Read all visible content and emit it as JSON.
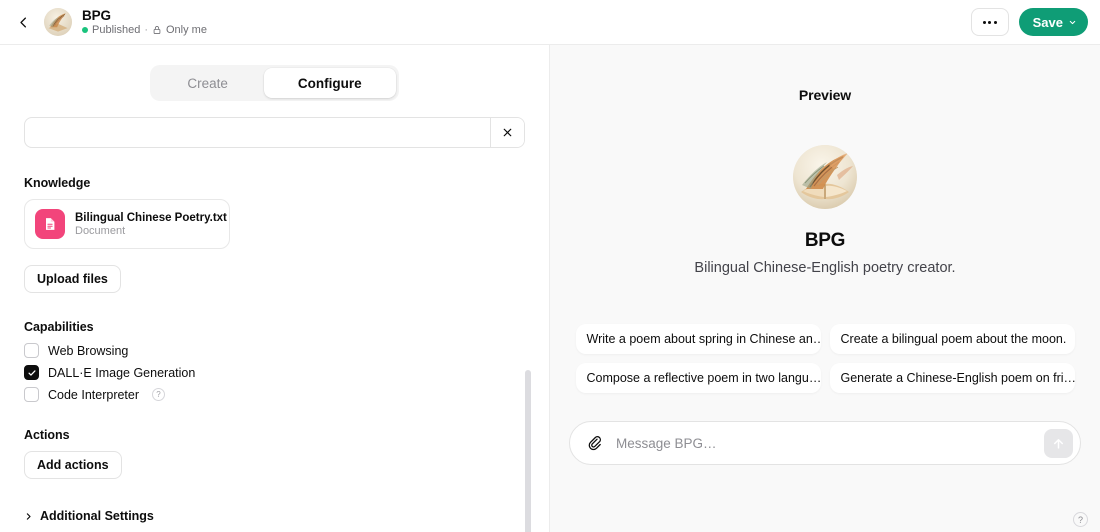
{
  "header": {
    "back_icon": "chevron-left-icon",
    "title": "BPG",
    "status": "Published",
    "separator": "·",
    "visibility": "Only me",
    "lock_icon": "lock-icon",
    "more_label": "more-options",
    "save_label": "Save",
    "accent_color": "#0f9d76",
    "status_dot_color": "#19c37d"
  },
  "tabs": [
    {
      "label": "Create",
      "active": false
    },
    {
      "label": "Configure",
      "active": true
    }
  ],
  "configure": {
    "text_field": {
      "value": "",
      "placeholder": ""
    },
    "clear_icon": "close-icon",
    "knowledge": {
      "label": "Knowledge",
      "file": {
        "name": "Bilingual Chinese Poetry.txt",
        "type": "Document",
        "icon": "document-icon",
        "icon_color": "#F2457B"
      },
      "upload_label": "Upload files"
    },
    "capabilities": {
      "label": "Capabilities",
      "items": [
        {
          "label": "Web Browsing",
          "checked": false,
          "help": false
        },
        {
          "label": "DALL·E Image Generation",
          "checked": true,
          "help": false
        },
        {
          "label": "Code Interpreter",
          "checked": false,
          "help": true,
          "help_glyph": "?"
        }
      ]
    },
    "actions": {
      "label": "Actions",
      "add_label": "Add actions"
    },
    "additional_settings": {
      "label": "Additional Settings",
      "chevron": "chevron-right-icon",
      "expanded": false
    }
  },
  "preview": {
    "title": "Preview",
    "avatar_name": "gpt-avatar",
    "gpt_name": "BPG",
    "gpt_description": "Bilingual Chinese-English poetry creator.",
    "starter_prompts": [
      "Write a poem about spring in Chinese an…",
      "Create a bilingual poem about the moon.",
      "Compose a reflective poem in two langu…",
      "Generate a Chinese-English poem on fri…"
    ],
    "composer": {
      "attach_icon": "paperclip-icon",
      "placeholder": "Message BPG…",
      "value": "",
      "send_icon": "arrow-up-icon",
      "send_enabled": false
    },
    "help_glyph": "?",
    "background_color": "#f9f9f9"
  }
}
